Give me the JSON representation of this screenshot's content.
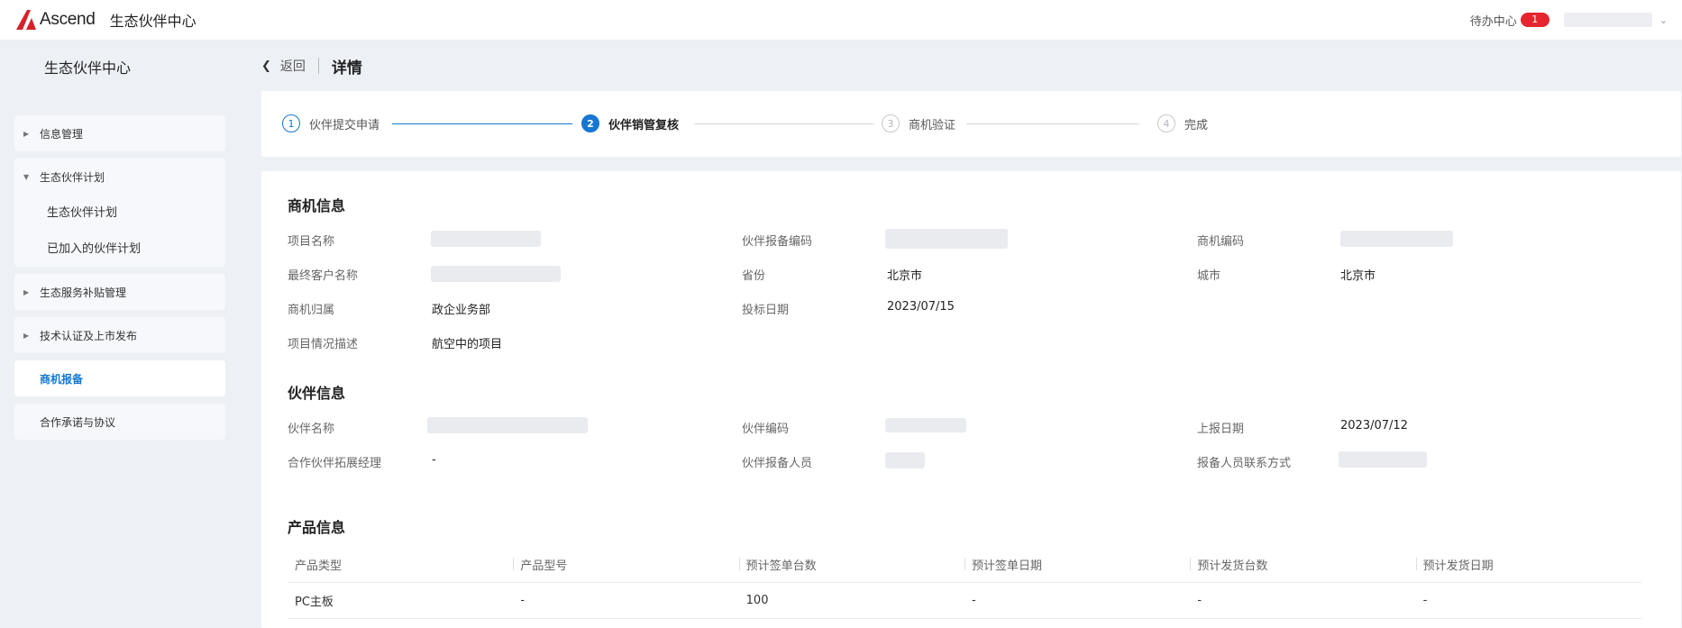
{
  "header": {
    "logo_text": "Ascend",
    "app_title": "生态伙伴中心",
    "todo_label": "待办中心",
    "todo_count": "1"
  },
  "sidebar": {
    "title": "生态伙伴中心",
    "items": [
      {
        "label": "信息管理"
      },
      {
        "label": "生态伙伴计划",
        "children": [
          "生态伙伴计划",
          "已加入的伙伴计划"
        ]
      },
      {
        "label": "生态服务补贴管理"
      },
      {
        "label": "技术认证及上市发布"
      },
      {
        "label": "商机报备"
      },
      {
        "label": "合作承诺与协议"
      }
    ]
  },
  "breadcrumb": {
    "back_label": "返回",
    "title": "详情"
  },
  "steps": [
    {
      "num": "1",
      "label": "伙伴提交申请"
    },
    {
      "num": "2",
      "label": "伙伴销管复核"
    },
    {
      "num": "3",
      "label": "商机验证"
    },
    {
      "num": "4",
      "label": "完成"
    }
  ],
  "opportunity": {
    "title": "商机信息",
    "project_name_label": "项目名称",
    "partner_report_code_label": "伙伴报备编码",
    "opportunity_code_label": "商机编码",
    "end_customer_label": "最终客户名称",
    "province_label": "省份",
    "province_value": "北京市",
    "city_label": "城市",
    "city_value": "北京市",
    "ownership_label": "商机归属",
    "ownership_value": "政企业务部",
    "bid_date_label": "投标日期",
    "bid_date_value": "2023/07/15",
    "description_label": "项目情况描述",
    "description_value": "航空中的项目"
  },
  "partner": {
    "title": "伙伴信息",
    "name_label": "伙伴名称",
    "code_label": "伙伴编码",
    "report_date_label": "上报日期",
    "report_date_value": "2023/07/12",
    "manager_label": "合作伙伴拓展经理",
    "manager_value": "-",
    "reporter_label": "伙伴报备人员",
    "contact_label": "报备人员联系方式"
  },
  "product": {
    "title": "产品信息",
    "columns": [
      "产品类型",
      "产品型号",
      "预计签单台数",
      "预计签单日期",
      "预计发货台数",
      "预计发货日期"
    ],
    "rows": [
      [
        "PC主板",
        "-",
        "100",
        "-",
        "-",
        "-"
      ]
    ]
  }
}
